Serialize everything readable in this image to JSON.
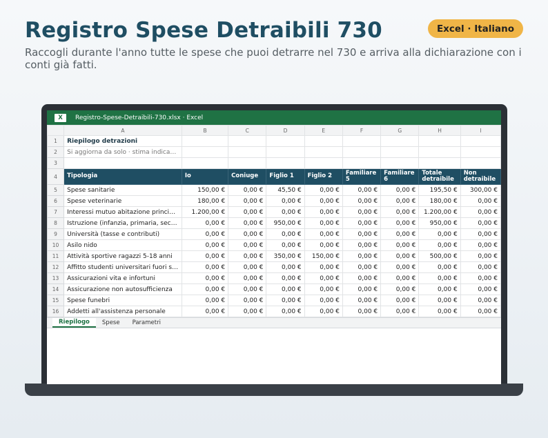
{
  "page": {
    "title": "Registro Spese Detraibili 730",
    "badge": "Excel · Italiano",
    "subtitle": "Raccogli durante l'anno tutte le spese che puoi detrarre nel 730 e arriva alla dichiarazione con i conti già fatti."
  },
  "excel": {
    "logo": "X",
    "filename": "Registro-Spese-Detraibili-730.xlsx · Excel",
    "columns": [
      "A",
      "B",
      "C",
      "D",
      "E",
      "F",
      "G",
      "H",
      "I"
    ],
    "summary_title": "Riepilogo detrazioni",
    "summary_note": "Si aggiorna da solo · stima indicati...",
    "headers": [
      "Tipologia",
      "Io",
      "Coniuge",
      "Figlio 1",
      "Figlio 2",
      "Familiare 5",
      "Familiare 6",
      "Totale detraibile",
      "Non detraibile"
    ],
    "rows": [
      [
        "Spese sanitarie",
        "150,00 €",
        "0,00 €",
        "45,50 €",
        "0,00 €",
        "0,00 €",
        "0,00 €",
        "195,50 €",
        "300,00 €"
      ],
      [
        "Spese veterinarie",
        "180,00 €",
        "0,00 €",
        "0,00 €",
        "0,00 €",
        "0,00 €",
        "0,00 €",
        "180,00 €",
        "0,00 €"
      ],
      [
        "Interessi mutuo abitazione princip...",
        "1.200,00 €",
        "0,00 €",
        "0,00 €",
        "0,00 €",
        "0,00 €",
        "0,00 €",
        "1.200,00 €",
        "0,00 €"
      ],
      [
        "Istruzione (infanzia, primaria, seco...",
        "0,00 €",
        "0,00 €",
        "950,00 €",
        "0,00 €",
        "0,00 €",
        "0,00 €",
        "950,00 €",
        "0,00 €"
      ],
      [
        "Università (tasse e contributi)",
        "0,00 €",
        "0,00 €",
        "0,00 €",
        "0,00 €",
        "0,00 €",
        "0,00 €",
        "0,00 €",
        "0,00 €"
      ],
      [
        "Asilo nido",
        "0,00 €",
        "0,00 €",
        "0,00 €",
        "0,00 €",
        "0,00 €",
        "0,00 €",
        "0,00 €",
        "0,00 €"
      ],
      [
        "Attività sportive ragazzi 5-18 anni",
        "0,00 €",
        "0,00 €",
        "350,00 €",
        "150,00 €",
        "0,00 €",
        "0,00 €",
        "500,00 €",
        "0,00 €"
      ],
      [
        "Affitto studenti universitari fuori se...",
        "0,00 €",
        "0,00 €",
        "0,00 €",
        "0,00 €",
        "0,00 €",
        "0,00 €",
        "0,00 €",
        "0,00 €"
      ],
      [
        "Assicurazioni vita e infortuni",
        "0,00 €",
        "0,00 €",
        "0,00 €",
        "0,00 €",
        "0,00 €",
        "0,00 €",
        "0,00 €",
        "0,00 €"
      ],
      [
        "Assicurazione non autosufficienza",
        "0,00 €",
        "0,00 €",
        "0,00 €",
        "0,00 €",
        "0,00 €",
        "0,00 €",
        "0,00 €",
        "0,00 €"
      ],
      [
        "Spese funebri",
        "0,00 €",
        "0,00 €",
        "0,00 €",
        "0,00 €",
        "0,00 €",
        "0,00 €",
        "0,00 €",
        "0,00 €"
      ],
      [
        "Addetti all'assistenza personale",
        "0,00 €",
        "0,00 €",
        "0,00 €",
        "0,00 €",
        "0,00 €",
        "0,00 €",
        "0,00 €",
        "0,00 €"
      ]
    ],
    "sheet_tabs": [
      "Riepilogo",
      "Spese",
      "Parametri"
    ],
    "active_tab": "Riepilogo"
  }
}
